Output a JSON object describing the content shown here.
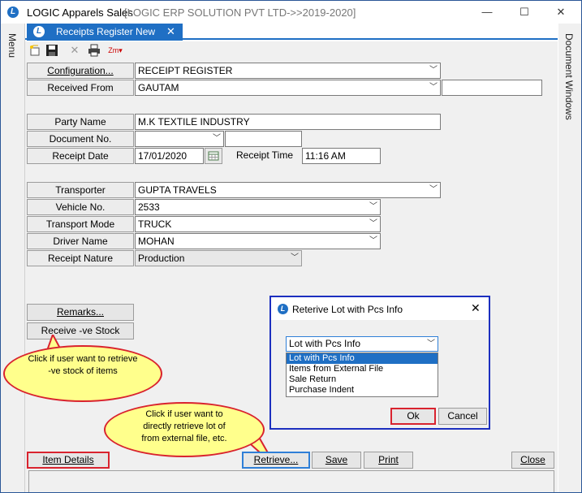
{
  "window": {
    "app_title": "LOGIC Apparels Sales",
    "subtitle": "[LOGIC ERP SOLUTION PVT LTD->>2019-2020]",
    "minimize": "—",
    "maximize": "☐",
    "close": "✕"
  },
  "side": {
    "menu": "Menu",
    "doc_windows": "Document Windows"
  },
  "tab": {
    "label": "Receipts Register New",
    "close": "✕"
  },
  "form": {
    "configuration_label": "Configuration...",
    "configuration_value": "RECEIPT REGISTER",
    "received_from_label": "Received From",
    "received_from_value": "GAUTAM",
    "received_from_extra": "",
    "party_name_label": "Party Name",
    "party_name_value": "M.K TEXTILE INDUSTRY",
    "document_no_label": "Document No.",
    "document_no_value": "",
    "document_no_extra": "",
    "receipt_date_label": "Receipt Date",
    "receipt_date_value": "17/01/2020",
    "receipt_time_label": "Receipt Time",
    "receipt_time_value": "11:16 AM",
    "transporter_label": "Transporter",
    "transporter_value": "GUPTA TRAVELS",
    "vehicle_no_label": "Vehicle No.",
    "vehicle_no_value": "2533",
    "transport_mode_label": "Transport Mode",
    "transport_mode_value": "TRUCK",
    "driver_name_label": "Driver Name",
    "driver_name_value": "MOHAN",
    "receipt_nature_label": "Receipt Nature",
    "receipt_nature_value": "Production"
  },
  "buttons": {
    "remarks": "Remarks...",
    "receive_ve_stock": "Receive -ve Stock",
    "item_details": "Item Details",
    "retrieve": "Retrieve...",
    "save": "Save",
    "print": "Print",
    "close": "Close"
  },
  "callouts": {
    "ve_stock": "Click if user want to retrieve -ve stock of items",
    "retrieve_lot": "Click if user want to directly retrieve lot of from external file, etc."
  },
  "dialog": {
    "title": "Reterive Lot with Pcs Info",
    "close": "✕",
    "selected": "Lot with Pcs Info",
    "options": [
      "Lot with Pcs Info",
      "Items from External File",
      "Sale Return",
      "Purchase Indent"
    ],
    "ok": "Ok",
    "cancel": "Cancel"
  },
  "icons": {
    "new": "new-document-icon",
    "save": "save-icon",
    "delete": "delete-icon",
    "print": "print-icon",
    "zoom": "zoom-icon"
  }
}
